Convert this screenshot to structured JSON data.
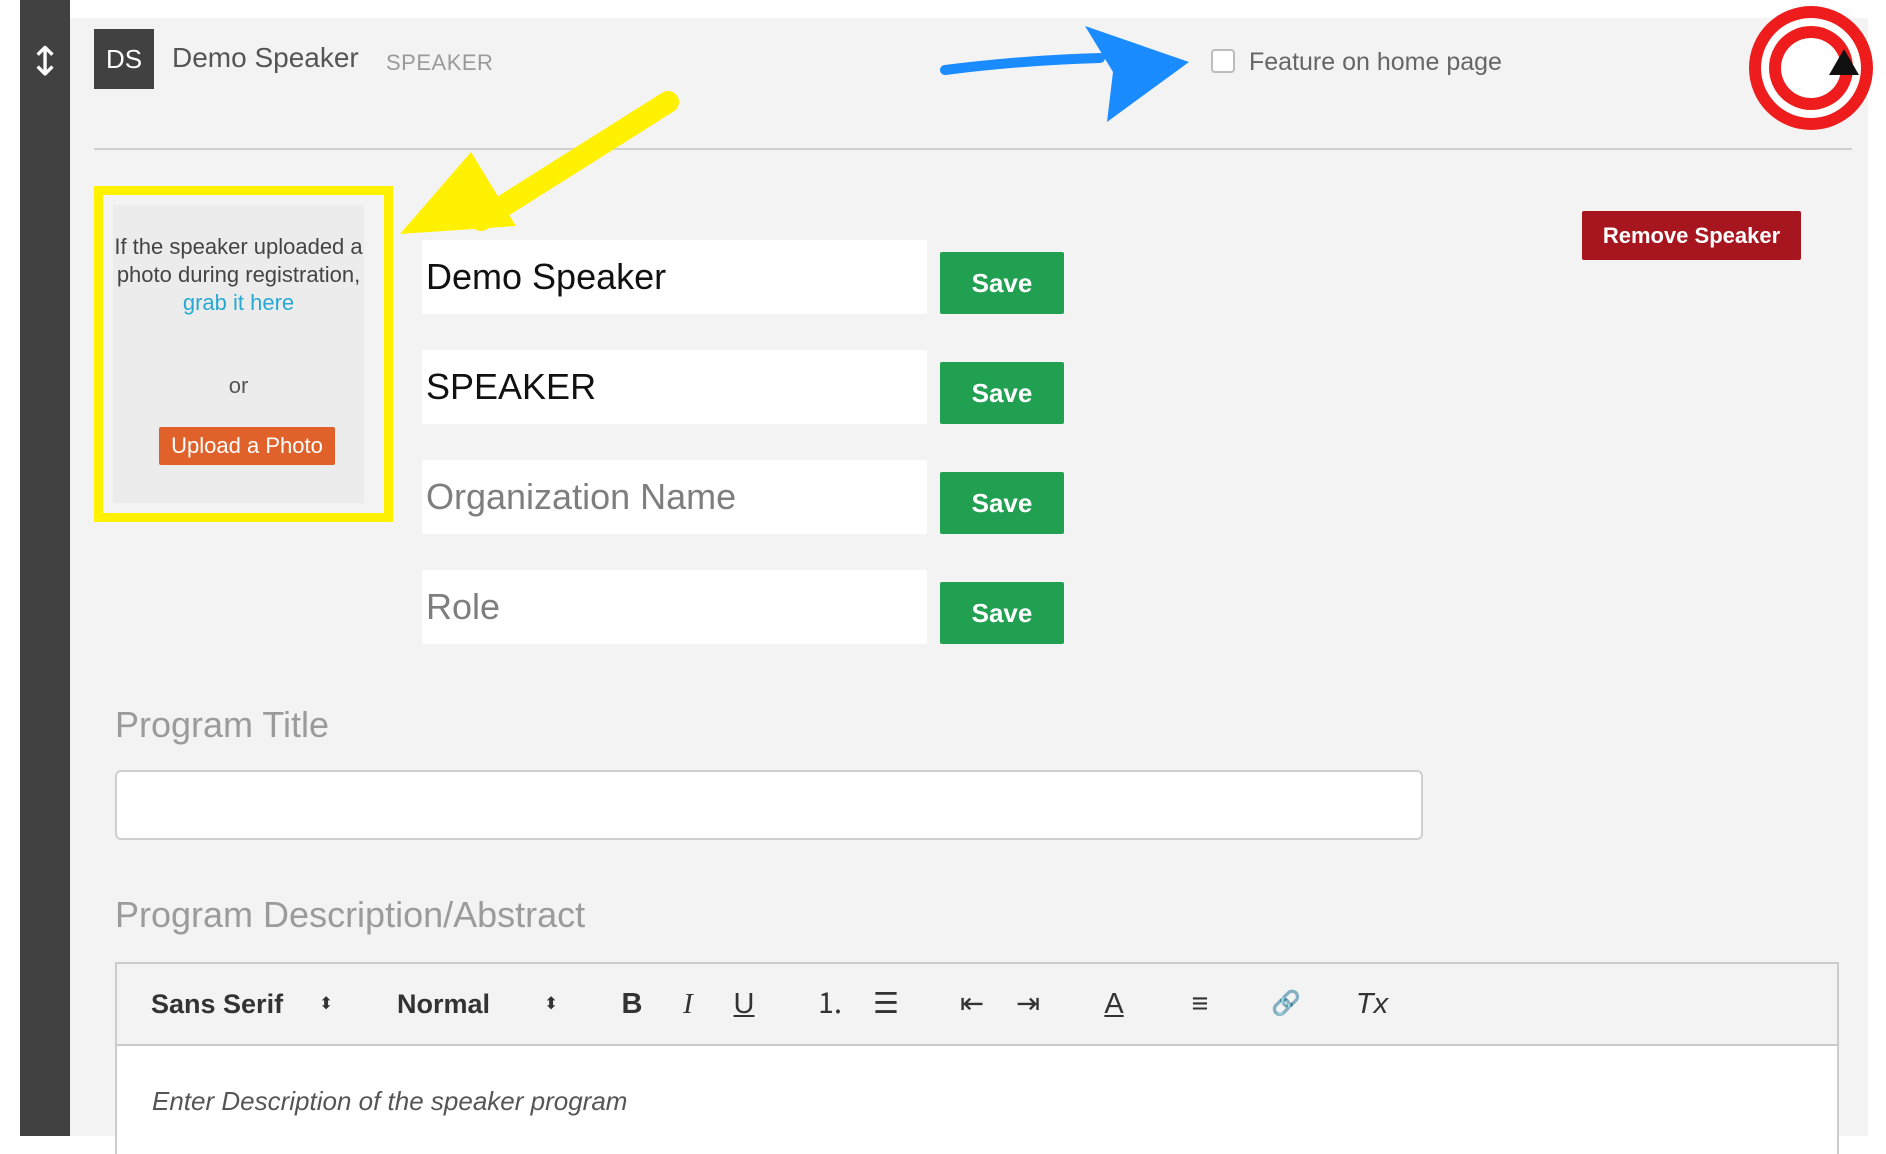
{
  "drag_handle": {
    "icon": "↕"
  },
  "header": {
    "initials": "DS",
    "name": "Demo Speaker",
    "role": "SPEAKER",
    "feature_label": "Feature on home page",
    "feature_checked": false,
    "collapse_icon": "▲"
  },
  "photo": {
    "help_text": "If the speaker uploaded a photo during registration,",
    "link_text": "grab it here",
    "or_text": "or",
    "upload_label": "Upload a Photo"
  },
  "fields": [
    {
      "value": "Demo Speaker",
      "placeholder": "",
      "save_label": "Save"
    },
    {
      "value": "SPEAKER",
      "placeholder": "",
      "save_label": "Save"
    },
    {
      "value": "",
      "placeholder": "Organization Name",
      "save_label": "Save"
    },
    {
      "value": "",
      "placeholder": "Role",
      "save_label": "Save"
    }
  ],
  "remove_label": "Remove Speaker",
  "program": {
    "title_label": "Program Title",
    "title_value": "",
    "description_label": "Program Description/Abstract",
    "description_placeholder": "Enter Description of the speaker program"
  },
  "toolbar": {
    "font": "Sans Serif",
    "size": "Normal",
    "caret": "⬍",
    "bold": "B",
    "italic": "I",
    "underline": "U",
    "ordered_list": "⒈",
    "bullet_list": "☰",
    "outdent": "⇤",
    "indent": "⇥",
    "color": "A",
    "align": "≡",
    "link": "🔗",
    "clean": "Tx"
  },
  "colors": {
    "save_green": "#21a052",
    "remove_red": "#a7151f",
    "upload_orange": "#e0622a",
    "link_blue": "#28a9d3",
    "annotation_yellow": "#fff100",
    "annotation_blue": "#1a8cff",
    "annotation_red": "#ee1c1c"
  }
}
